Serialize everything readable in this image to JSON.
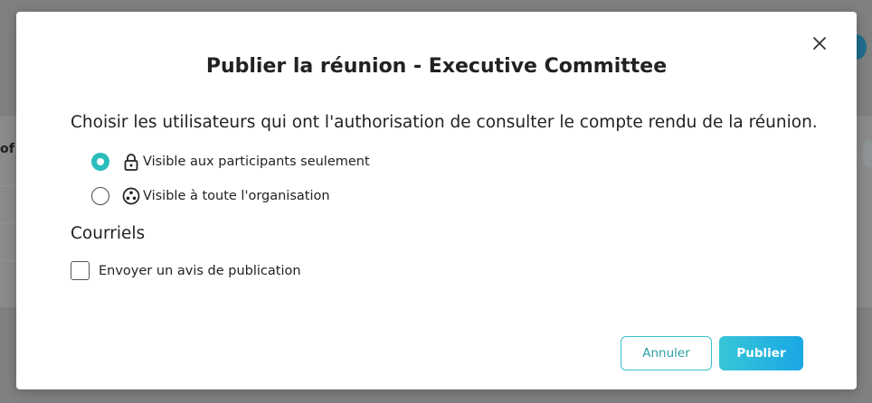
{
  "modal": {
    "title": "Publier la réunion - Executive Committee",
    "instruction": "Choisir les utilisateurs qui ont l'authorisation de consulter le compte rendu de la réunion.",
    "visibility_options": [
      {
        "label": "Visible aux participants seulement",
        "icon": "lock-icon",
        "checked": true
      },
      {
        "label": "Visible à toute l'organisation",
        "icon": "organization-icon",
        "checked": false
      }
    ],
    "emails_section_title": "Courriels",
    "send_notice_label": "Envoyer un avis de publication",
    "send_notice_checked": false,
    "cancel_label": "Annuler",
    "publish_label": "Publier"
  },
  "background": {
    "partial_text": "of t"
  },
  "colors": {
    "accent": "#2bbcbc",
    "publish_gradient_start": "#37c6d8",
    "publish_gradient_end": "#1aa7e4"
  }
}
